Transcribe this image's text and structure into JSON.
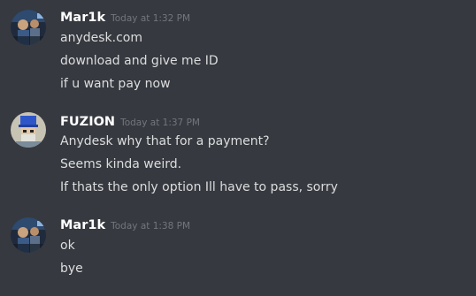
{
  "messages": [
    {
      "author": "Mar1k",
      "timestamp": "Today at 1:32 PM",
      "avatar_icon": "avatar-mar1k-icon",
      "lines": [
        "anydesk.com",
        "download and give me ID",
        "if u want pay now"
      ]
    },
    {
      "author": "FUZION",
      "timestamp": "Today at 1:37 PM",
      "avatar_icon": "avatar-fuzion-icon",
      "lines": [
        "Anydesk why that for a payment?",
        "Seems kinda weird.",
        "If thats the only option Ill have to pass, sorry"
      ]
    },
    {
      "author": "Mar1k",
      "timestamp": "Today at 1:38 PM",
      "avatar_icon": "avatar-mar1k-icon",
      "lines": [
        "ok",
        "bye"
      ]
    }
  ],
  "colors": {
    "background": "#36393f",
    "username": "#ffffff",
    "text": "#dcddde",
    "timestamp": "#72767d"
  }
}
